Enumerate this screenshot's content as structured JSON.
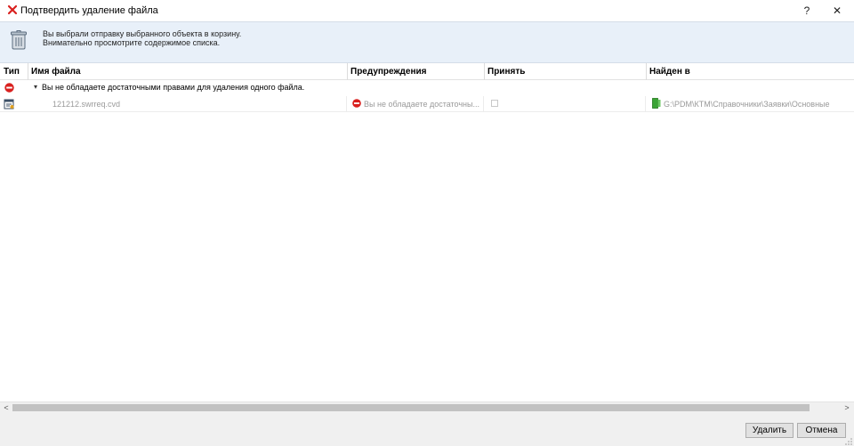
{
  "window": {
    "title": "Подтвердить удаление файла",
    "title_icon": "red-x-icon",
    "help_label": "?",
    "close_label": "✕"
  },
  "info": {
    "icon": "recycle-bin-icon",
    "line1": "Вы выбрали отправку выбранного объекта в корзину.",
    "line2": "Внимательно просмотрите содержимое списка."
  },
  "grid": {
    "columns": [
      "Тип",
      "Имя файла",
      "Предупреждения",
      "Принять",
      "Найден в"
    ],
    "group": {
      "icon": "stop-icon",
      "label": "Вы не обладаете достаточными правами для удаления одного файла."
    },
    "rows": [
      {
        "type_icon": "drawing-file-icon",
        "file_name": "121212.swrreq.cvd",
        "warning_icon": "stop-icon",
        "warning": "Вы не обладаете достаточны...",
        "accept": false,
        "folder_icon": "green-folder-icon",
        "found_in": "G:\\PDM\\КТМ\\Справочники\\Заявки\\Основные"
      }
    ]
  },
  "scroll": {
    "left_arrow": "<",
    "right_arrow": ">"
  },
  "footer": {
    "delete_label": "Удалить",
    "cancel_label": "Отмена"
  },
  "colors": {
    "stop_red": "#d9201e",
    "info_bg": "#e8f0f9",
    "folder_green": "#3aa335"
  }
}
